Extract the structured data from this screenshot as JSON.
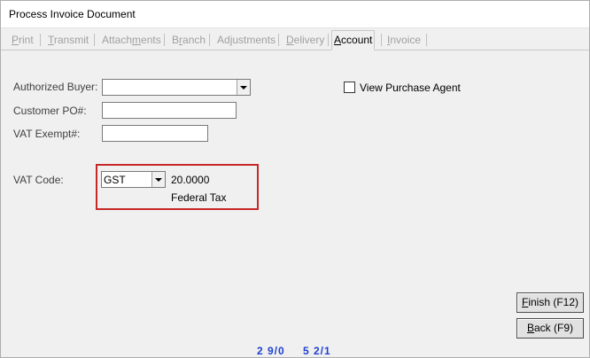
{
  "window": {
    "title": "Process Invoice Document"
  },
  "tabs": [
    {
      "pre": "",
      "u": "P",
      "post": "rint",
      "state": "disabled"
    },
    {
      "pre": "",
      "u": "T",
      "post": "ransmit",
      "state": "disabled"
    },
    {
      "pre": "Attach",
      "u": "m",
      "post": "ents",
      "state": "disabled"
    },
    {
      "pre": "B",
      "u": "r",
      "post": "anch",
      "state": "disabled"
    },
    {
      "pre": "Ad",
      "u": "j",
      "post": "ustments",
      "state": "disabled"
    },
    {
      "pre": "",
      "u": "D",
      "post": "elivery",
      "state": "disabled"
    },
    {
      "pre": "",
      "u": "A",
      "post": "ccount",
      "state": "active"
    },
    {
      "pre": "",
      "u": "I",
      "post": "nvoice",
      "state": "disabled"
    }
  ],
  "form": {
    "authorized_buyer_label": "Authorized Buyer:",
    "authorized_buyer_value": "",
    "customer_po_label": "Customer PO#:",
    "customer_po_value": "",
    "vat_exempt_label": "VAT Exempt#:",
    "vat_exempt_value": "",
    "view_purchase_agent_label": "View Purchase Agent",
    "view_purchase_agent_checked": false,
    "vat_code_label": "VAT Code:",
    "vat_code_value": "GST",
    "vat_rate": "20.0000",
    "vat_description": "Federal Tax"
  },
  "buttons": {
    "finish": {
      "pre": "",
      "u": "F",
      "post": "inish (F12)"
    },
    "back": {
      "pre": "",
      "u": "B",
      "post": "ack (F9)"
    }
  },
  "status": {
    "left": "2 9/0",
    "right": "5 2/1",
    "color": "#1f3fd1"
  },
  "colors": {
    "highlight": "#c62828"
  }
}
